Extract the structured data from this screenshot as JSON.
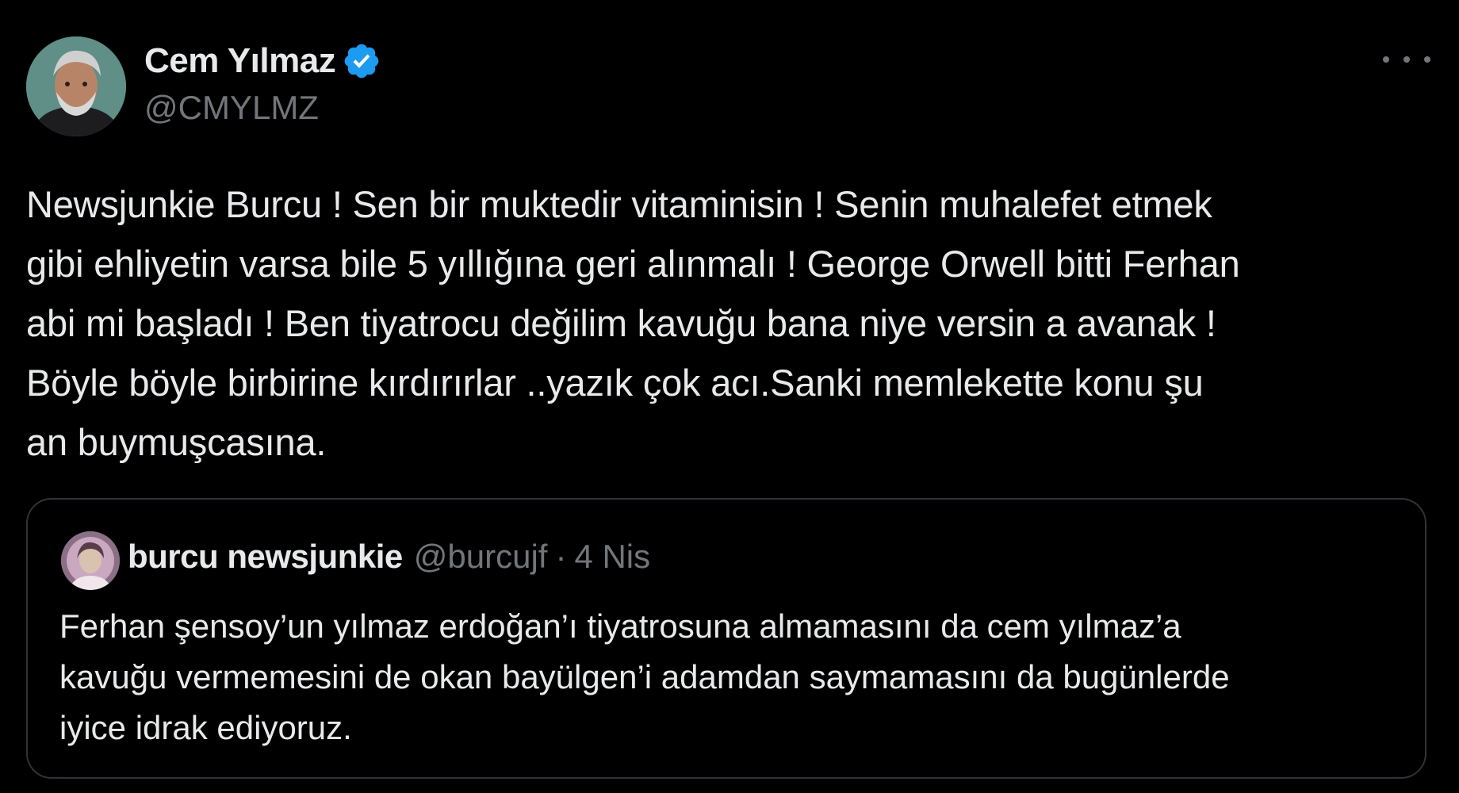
{
  "author": {
    "display_name": "Cem Yılmaz",
    "handle": "@CMYLMZ",
    "verified": true,
    "avatar_icon": "profile-photo",
    "verified_color": "#1d9bf0"
  },
  "tweet": {
    "text": "Newsjunkie Burcu ! Sen bir muktedir vitaminisin ! Senin muhalefet etmek\ngibi ehliyetin varsa bile 5 yıllığına geri alınmalı ! George Orwell bitti Ferhan\nabi mi başladı ! Ben tiyatrocu değilim kavuğu bana niye versin a avanak !\nBöyle böyle birbirine kırdırırlar ..yazık çok acı.Sanki memlekette konu şu\nan buymuşcasına."
  },
  "quoted_tweet": {
    "display_name": "burcu newsjunkie",
    "handle": "@burcujf",
    "separator": "·",
    "date": "4 Nis",
    "text": "Ferhan şensoy’un yılmaz erdoğan’ı tiyatrosuna almamasını da cem yılmaz’a\nkavuğu vermemesini de okan bayülgen’i adamdan saymamasını da bugünlerde\niyice idrak ediyoruz."
  },
  "colors": {
    "background": "#000000",
    "text_primary": "#e7e9ea",
    "text_secondary": "#71767b",
    "border": "#2f3336"
  }
}
